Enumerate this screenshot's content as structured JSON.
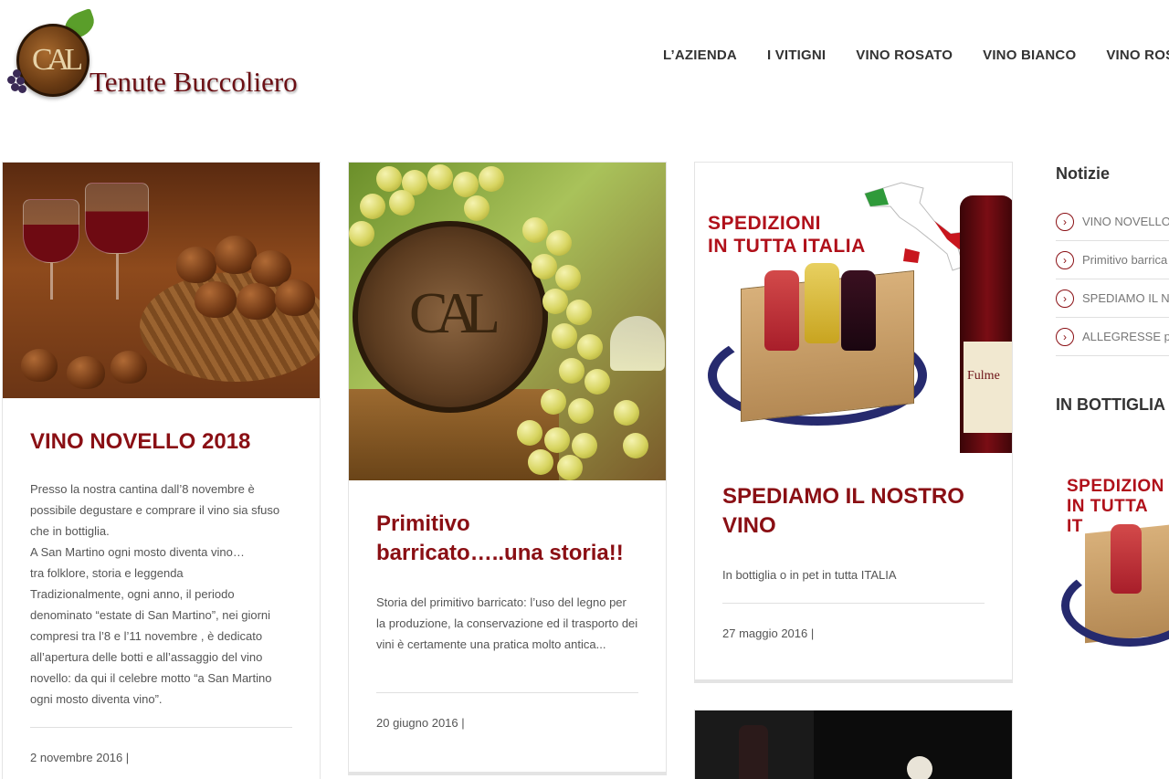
{
  "header": {
    "brand_name": "Tenute Buccoliero",
    "nav": [
      "L’AZIENDA",
      "I VITIGNI",
      "VINO ROSATO",
      "VINO BIANCO",
      "VINO ROSSO"
    ]
  },
  "posts": [
    {
      "title": "VINO NOVELLO 2018",
      "excerpt": [
        "Presso la nostra cantina dall’8 novembre è possibile degustare e comprare il vino sia sfuso che in bottiglia.",
        "A San Martino ogni mosto diventa vino…",
        "tra  folklore, storia e leggenda",
        "Tradizionalmente, ogni anno, il periodo denominato “estate di San Martino”, nei giorni compresi tra l’8 e l’11 novembre , è dedicato all’apertura delle botti e all’assaggio del vino novello:  da qui il celebre motto “a San Martino ogni mosto diventa vino”."
      ],
      "date": "2 novembre 2016 |"
    },
    {
      "title": "Primitivo barricato…..una storia!!",
      "excerpt": [
        "Storia del primitivo barricato: l’uso del legno per la produzione, la conservazione ed il trasporto dei vini è certamente una pratica molto antica..."
      ],
      "date": "20 giugno 2016 |"
    },
    {
      "title": "SPEDIAMO IL NOSTRO VINO",
      "excerpt": [
        "In bottiglia o in pet in tutta ITALIA"
      ],
      "date": "27 maggio 2016 |",
      "image_text": [
        "SPEDIZIONI",
        "IN TUTTA ITALIA"
      ],
      "bottle_label": "Fulme"
    }
  ],
  "sidebar": {
    "news_title": "Notizie",
    "news_items": [
      "VINO NOVELLO",
      "Primitivo barrica",
      "SPEDIAMO IL NO",
      "ALLEGRESSE pri"
    ],
    "bottle_title": "IN BOTTIGLIA C",
    "image_text": [
      "SPEDIZION",
      "IN TUTTA IT"
    ]
  },
  "colors": {
    "accent": "#8a0f14",
    "nav_text": "#333333",
    "body_text": "#555555"
  }
}
